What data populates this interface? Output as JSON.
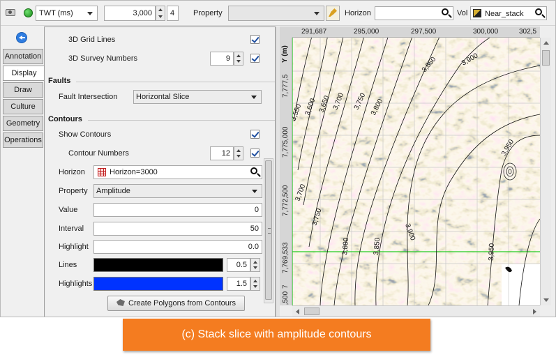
{
  "toolbar": {
    "domain_label": "TWT (ms)",
    "time_value": "3,000",
    "step_value": "4",
    "property_label": "Property",
    "property_value": "",
    "horizon_label": "Horizon",
    "horizon_value": "",
    "vol_label": "Vol",
    "vol_value": "Near_stack"
  },
  "tabs": [
    "Annotation",
    "Display",
    "Draw",
    "Culture",
    "Geometry",
    "Operations"
  ],
  "active_tab": "Display",
  "panel": {
    "grid_lines_label": "3D Grid Lines",
    "survey_numbers_label": "3D Survey Numbers",
    "survey_numbers_value": "9",
    "faults_header": "Faults",
    "fault_intersection_label": "Fault Intersection",
    "fault_intersection_value": "Horizontal Slice",
    "contours_header": "Contours",
    "show_contours_label": "Show Contours",
    "contour_numbers_label": "Contour Numbers",
    "contour_numbers_value": "12",
    "horizon_label": "Horizon",
    "horizon_value": "Horizon=3000",
    "property_label": "Property",
    "property_value": "Amplitude",
    "value_label": "Value",
    "value_value": "0",
    "interval_label": "Interval",
    "interval_value": "50",
    "highlight_label": "Highlight",
    "highlight_value": "0.0",
    "lines_label": "Lines",
    "lines_value": "0.5",
    "highlights_label": "Highlights",
    "highlights_value": "1.5",
    "create_button": "Create Polygons from Contours"
  },
  "colors": {
    "lines_color": "#000000",
    "highlights_color": "#0033ff",
    "caption_bg": "#f47c20",
    "grid_highlight": "#22cc22"
  },
  "map": {
    "x_ticks": [
      "291,687",
      "295,000",
      "297,500",
      "300,000",
      "302,5"
    ],
    "y_unit": "Y (m)",
    "y_ticks": [
      "7,777,5",
      "7,775,000",
      "7,772,500",
      "7,769,533",
      "7",
      "767,500"
    ],
    "contour_labels": [
      "3,850",
      "3,900",
      "3,550",
      "3,600",
      "3,650",
      "3,700",
      "3,750",
      "3,800",
      "3,950",
      "3,700",
      "3,750",
      "3,800",
      "3,850",
      "3,900",
      "3,950"
    ]
  },
  "caption": "(c) Stack slice with amplitude contours"
}
